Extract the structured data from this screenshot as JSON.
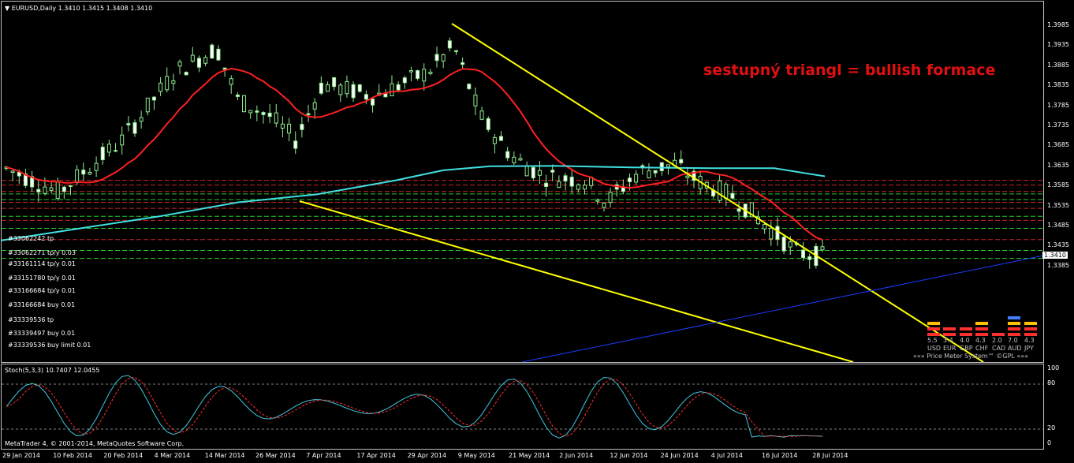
{
  "chart": {
    "menu_icon": "dropdown-arrow-icon",
    "header": "EURUSD,Daily  1.3410 1.3415 1.3408 1.3410",
    "current_price": "1.3410",
    "annotation": "sestupný triangl = bullish formace",
    "price_axis": [
      "1.3985",
      "1.3935",
      "1.3885",
      "1.3835",
      "1.3785",
      "1.3735",
      "1.3685",
      "1.3635",
      "1.3585",
      "1.3535",
      "1.3485",
      "1.3435",
      "1.3385"
    ],
    "date_axis": [
      "29 Jan 2014",
      "10 Feb 2014",
      "20 Feb 2014",
      "4 Mar 2014",
      "14 Mar 2014",
      "26 Mar 2014",
      "7 Apr 2014",
      "17 Apr 2014",
      "29 Apr 2014",
      "9 May 2014",
      "21 May 2014",
      "2 Jun 2014",
      "12 Jun 2014",
      "24 Jun 2014",
      "4 Jul 2014",
      "16 Jul 2014",
      "28 Jul 2014"
    ],
    "orders": [
      "#33062242 tp",
      "#33062271 tp/y 0.03",
      "#33161114 tp/y 0.01",
      "#33151780 tp/y 0.01",
      "#33166684 tp/y 0.01",
      "#33166684 buy 0.01",
      "#33339536 tp",
      "#33339497 buy 0.01",
      "#33339536 buy limit 0.01"
    ],
    "colors": {
      "bull": "#90ee90",
      "bear": "#ffffff",
      "ma_fast": "#ff2020",
      "ma_slow": "#40e0e0",
      "triangle": "#ffff00",
      "trend": "#1a3cff"
    }
  },
  "oscillator": {
    "header": "Stoch(5,3,3) 10.7407 12.0455",
    "levels": [
      "100",
      "80",
      "20",
      "0"
    ]
  },
  "meter": {
    "values": [
      "5.5",
      "3.4",
      "4.0",
      "4.3",
      "2.0",
      "7.0",
      "4.3"
    ],
    "currencies": [
      "USD",
      "EUR",
      "GBP",
      "CHF",
      "CAD",
      "AUD",
      "JPY"
    ],
    "caption": "»»» Price Meter System™ ©GPL «««"
  },
  "footer": {
    "copyright": "MetaTrader 4, © 2001-2014, MetaQuotes Software Corp."
  }
}
